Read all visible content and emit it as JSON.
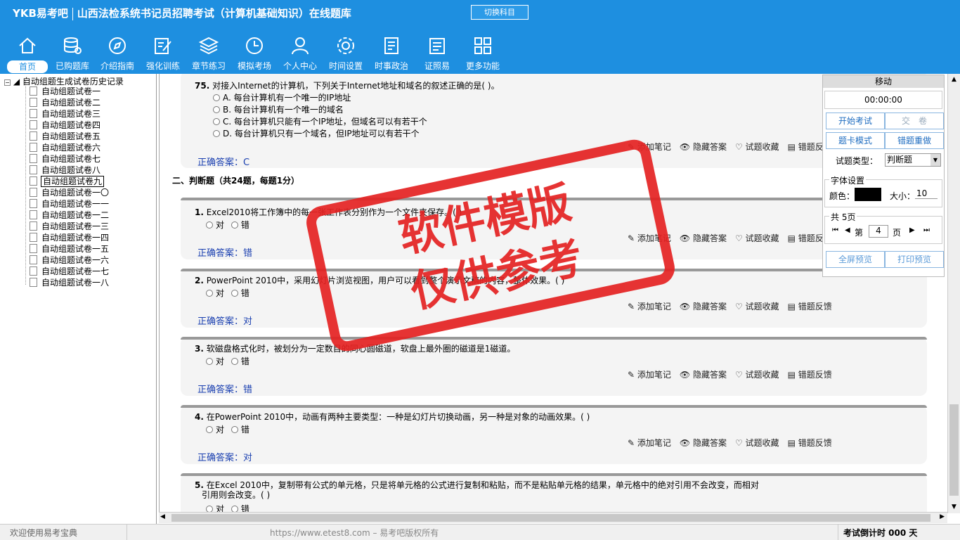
{
  "header": {
    "logo": "YKB易考吧",
    "title": "山西法检系统书记员招聘考试（计算机基础知识）在线题库",
    "switch_label": "切换科目"
  },
  "nav": [
    {
      "label": "首页",
      "icon": "home-icon"
    },
    {
      "label": "已购题库",
      "icon": "database-icon"
    },
    {
      "label": "介绍指南",
      "icon": "compass-icon"
    },
    {
      "label": "强化训练",
      "icon": "edit-icon"
    },
    {
      "label": "章节练习",
      "icon": "layers-icon"
    },
    {
      "label": "模拟考场",
      "icon": "clock-icon"
    },
    {
      "label": "个人中心",
      "icon": "user-icon"
    },
    {
      "label": "时间设置",
      "icon": "gear-icon"
    },
    {
      "label": "时事政治",
      "icon": "news-icon"
    },
    {
      "label": "证照易",
      "icon": "clipboard-icon"
    },
    {
      "label": "更多功能",
      "icon": "grid-icon"
    }
  ],
  "tree": {
    "root": "自动组题生成试卷历史记录",
    "items": [
      "自动组题试卷一",
      "自动组题试卷二",
      "自动组题试卷三",
      "自动组题试卷四",
      "自动组题试卷五",
      "自动组题试卷六",
      "自动组题试卷七",
      "自动组题试卷八",
      "自动组题试卷九",
      "自动组题试卷一〇",
      "自动组题试卷一一",
      "自动组题试卷一二",
      "自动组题试卷一三",
      "自动组题试卷一四",
      "自动组题试卷一五",
      "自动组题试卷一六",
      "自动组题试卷一七",
      "自动组题试卷一八"
    ]
  },
  "q75": {
    "num": "75.",
    "text": "对接入Internet的计算机，下列关于Internet地址和域名的叙述正确的是( )。",
    "options": [
      "A. 每台计算机有一个唯一的IP地址",
      "B. 每台计算机有一个唯一的域名",
      "C. 每台计算机只能有一个IP地址，但域名可以有若干个",
      "D. 每台计算机只有一个域名，但IP地址可以有若干个"
    ],
    "answer": "正确答案：C"
  },
  "section2": "二、判断题（共24题，每题1分）",
  "actions": [
    "添加笔记",
    "隐藏答案",
    "试题收藏",
    "错题反馈"
  ],
  "tf_options": [
    "对",
    "错"
  ],
  "tf": [
    {
      "num": "1.",
      "text": "Excel2010将工作簿中的每一张工作表分别作为一个文件夹保存。( )",
      "answer": "正确答案：错"
    },
    {
      "num": "2.",
      "text": "PowerPoint 2010中，采用幻灯片浏览视图，用户可以看到整个演示文稿的内容，整体效果。( )",
      "answer": "正确答案：对"
    },
    {
      "num": "3.",
      "text": "软磁盘格式化时，被划分为一定数目的同心圆磁道，软盘上最外圈的磁道是1磁道。",
      "answer": "正确答案：错"
    },
    {
      "num": "4.",
      "text": "在PowerPoint 2010中，动画有两种主要类型：一种是幻灯片切换动画，另一种是对象的动画效果。( )",
      "answer": "正确答案：对"
    },
    {
      "num": "5.",
      "text": "在Excel 2010中，复制带有公式的单元格，只是将单元格的公式进行复制和粘贴，而不是粘贴单元格的结果，单元格中的绝对引用不会改变，而相对",
      "text2": "引用则会改变。( )"
    }
  ],
  "panel": {
    "title": "移动",
    "timer": "00:00:00",
    "start": "开始考试",
    "submit": "交　卷",
    "card_mode": "题卡模式",
    "redo": "错题重做",
    "type_label": "试题类型：",
    "type_value": "判断题",
    "font_legend": "字体设置",
    "color_label": "颜色：",
    "size_label": "大小：",
    "size_value": "10",
    "pages_legend": "共 5页",
    "page_prefix": "第",
    "page_value": "4",
    "page_suffix": "页",
    "fullscreen": "全屏预览",
    "print": "打印预览",
    "font_color": "#000000"
  },
  "status": {
    "left": "欢迎使用易考宝典",
    "center": "https://www.etest8.com – 易考吧版权所有",
    "right": "考试倒计时 000 天"
  },
  "watermark": {
    "line1": "软件模版",
    "line2": "仅供参考"
  },
  "colors": {
    "brand": "#1e8fe0",
    "answer": "#1a3fb0",
    "stamp": "#e42222"
  }
}
